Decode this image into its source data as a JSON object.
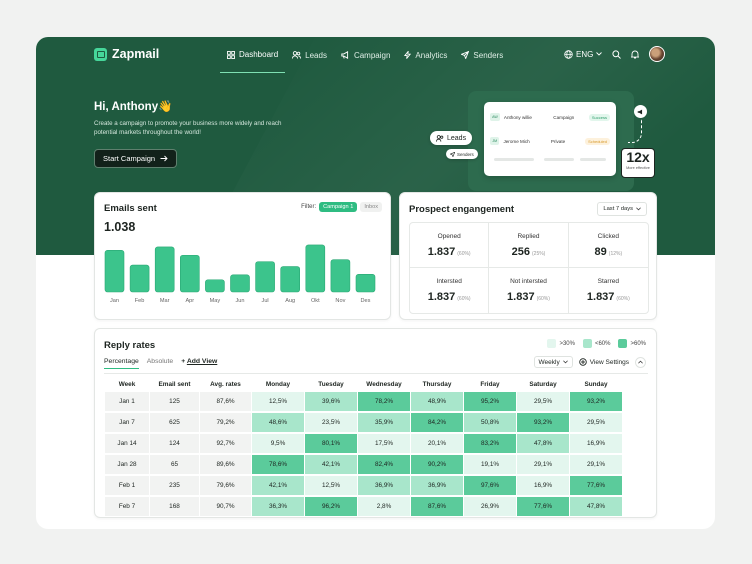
{
  "app": {
    "name": "Zapmail"
  },
  "nav": {
    "items": [
      {
        "label": "Dashboard",
        "icon": "grid-icon",
        "active": true
      },
      {
        "label": "Leads",
        "icon": "users-icon",
        "active": false
      },
      {
        "label": "Campaign",
        "icon": "megaphone-icon",
        "active": false
      },
      {
        "label": "Analytics",
        "icon": "bolt-icon",
        "active": false
      },
      {
        "label": "Senders",
        "icon": "send-icon",
        "active": false
      }
    ],
    "language": "ENG"
  },
  "hero": {
    "greeting": "Hi, Anthony👋",
    "subtitle": "Create a campaign to promote your business more widely and reach potential markets throughout the world!",
    "cta_label": "Start Campaign",
    "illustration": {
      "rows": [
        {
          "initials": "AW",
          "name": "Anthony willie",
          "type": "Campaign",
          "status": "Success"
        },
        {
          "initials": "JM",
          "name": "Jerome Mich",
          "type": "Private",
          "status": "Scheduled"
        }
      ],
      "leads_label": "Leads",
      "senders_label": "Senders",
      "multiplier": "12x",
      "multiplier_caption": "More effective"
    }
  },
  "emails_sent": {
    "title": "Emails sent",
    "filter_label": "Filter:",
    "filters": [
      "Campaign 1",
      "Inbox"
    ],
    "total": "1.038"
  },
  "prospect": {
    "title": "Prospect engangement",
    "period": "Last 7 days",
    "metrics": [
      {
        "label": "Opened",
        "value": "1.837",
        "pct": "(60%)"
      },
      {
        "label": "Replied",
        "value": "256",
        "pct": "(25%)"
      },
      {
        "label": "Clicked",
        "value": "89",
        "pct": "(12%)"
      },
      {
        "label": "Intersted",
        "value": "1.837",
        "pct": "(60%)"
      },
      {
        "label": "Not intersted",
        "value": "1.837",
        "pct": "(60%)"
      },
      {
        "label": "Starred",
        "value": "1.837",
        "pct": "(60%)"
      }
    ]
  },
  "reply_rates": {
    "title": "Reply rates",
    "legend": [
      {
        "label": ">30%",
        "color": "#e3f6ee"
      },
      {
        "label": "<60%",
        "color": "#a8e6cb"
      },
      {
        "label": ">60%",
        "color": "#5bcb9b"
      }
    ],
    "tabs": [
      "Percentage",
      "Absolute"
    ],
    "add_view": "Add View",
    "period_select": "Weekly",
    "settings_label": "View Settings",
    "columns": [
      "Week",
      "Email sent",
      "Avg. rates",
      "Monday",
      "Tuesday",
      "Wednesday",
      "Thursday",
      "Friday",
      "Saturday",
      "Sunday"
    ],
    "rows": [
      [
        "Jan 1",
        "125",
        "87,6%",
        "12,5%",
        "39,6%",
        "78,2%",
        "48,9%",
        "95,2%",
        "29,5%",
        "93,2%"
      ],
      [
        "Jan 7",
        "625",
        "79,2%",
        "48,6%",
        "23,5%",
        "35,9%",
        "84,2%",
        "50,8%",
        "93,2%",
        "29,5%"
      ],
      [
        "Jan 14",
        "124",
        "92,7%",
        "9,5%",
        "80,1%",
        "17,5%",
        "20,1%",
        "83,2%",
        "47,8%",
        "16,9%"
      ],
      [
        "Jan 28",
        "65",
        "89,6%",
        "78,6%",
        "42,1%",
        "82,4%",
        "90,2%",
        "19,1%",
        "29,1%",
        "29,1%"
      ],
      [
        "Feb 1",
        "235",
        "79,6%",
        "42,1%",
        "12,5%",
        "36,9%",
        "36,9%",
        "97,6%",
        "16,9%",
        "77,6%"
      ],
      [
        "Feb 7",
        "168",
        "90,7%",
        "36,3%",
        "96,2%",
        "2,8%",
        "87,6%",
        "26,9%",
        "77,6%",
        "47,8%"
      ]
    ]
  },
  "chart_data": {
    "type": "bar",
    "title": "Emails sent",
    "categories": [
      "Jan",
      "Feb",
      "Mar",
      "Apr",
      "May",
      "Jun",
      "Jul",
      "Aug",
      "Okt",
      "Nov",
      "Des"
    ],
    "values": [
      85,
      55,
      92,
      75,
      25,
      35,
      62,
      52,
      96,
      66,
      36
    ],
    "ylim": [
      0,
      100
    ],
    "color": "#3cc48c"
  }
}
